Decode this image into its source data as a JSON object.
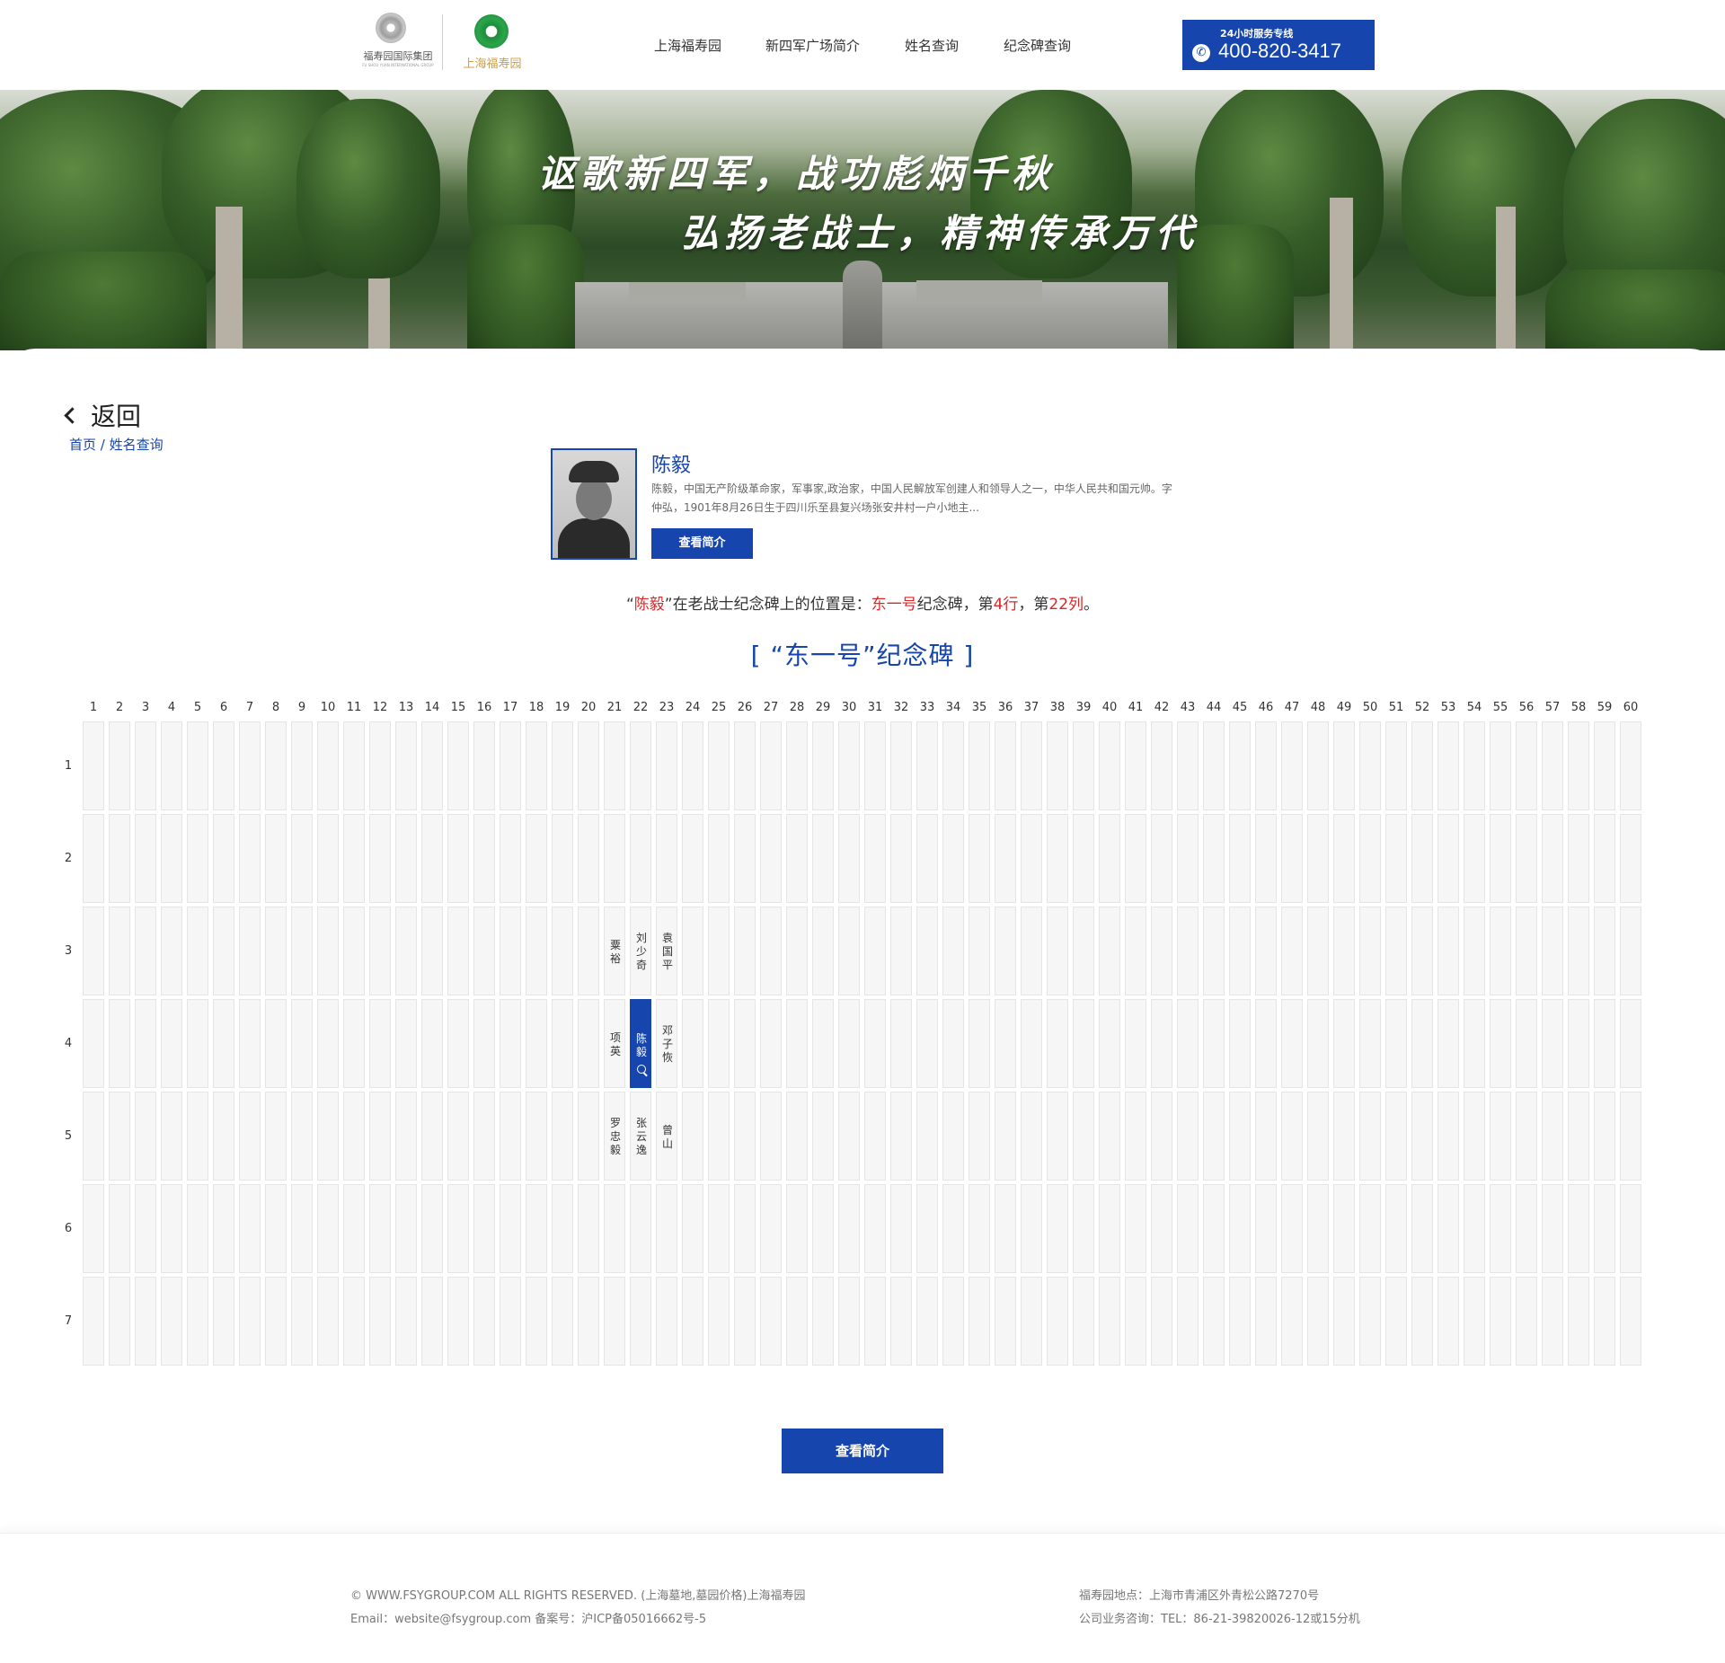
{
  "header": {
    "logo_group_name": "福寿园国际集团",
    "logo_group_sub": "FU SHOU YUAN INTERNATIONAL GROUP",
    "logo_park_name": "上海福寿园",
    "nav": [
      "上海福寿园",
      "新四军广场简介",
      "姓名查询",
      "纪念碑查询"
    ],
    "hotline_title": "24小时服务专线",
    "hotline_number": "400-820-3417"
  },
  "banner": {
    "slogan_line1": "讴歌新四军，战功彪炳千秋",
    "slogan_line2": "弘扬老战士，精神传承万代"
  },
  "content": {
    "back_label": "返回",
    "breadcrumb": "首页 / 姓名查询",
    "profile": {
      "name": "陈毅",
      "description": "陈毅，中国无产阶级革命家，军事家,政治家，中国人民解放军创建人和领导人之一，中华人民共和国元帅。字仲弘，1901年8月26日生于四川乐至县复兴场张安井村一户小地主...",
      "button_label": "查看简介"
    },
    "location": {
      "open_quote": "“",
      "name": "陈毅",
      "mid1": "”在老战士纪念碑上的位置是：",
      "monument": "东一号",
      "mid2": "纪念碑，第",
      "row": "4行",
      "mid3": "，第",
      "col": "22列",
      "end": "。"
    },
    "monument_title": "[ “东一号”纪念碑 ]",
    "grid": {
      "columns": 60,
      "rows": 7,
      "entries": [
        {
          "row": 3,
          "col": 21,
          "name": "粟裕"
        },
        {
          "row": 3,
          "col": 22,
          "name": "刘少奇"
        },
        {
          "row": 3,
          "col": 23,
          "name": "袁国平"
        },
        {
          "row": 4,
          "col": 21,
          "name": "项英"
        },
        {
          "row": 4,
          "col": 22,
          "name": "陈毅",
          "active": true
        },
        {
          "row": 4,
          "col": 23,
          "name": "邓子恢"
        },
        {
          "row": 5,
          "col": 21,
          "name": "罗忠毅"
        },
        {
          "row": 5,
          "col": 22,
          "name": "张云逸"
        },
        {
          "row": 5,
          "col": 23,
          "name": "曾山"
        }
      ]
    },
    "bottom_button_label": "查看简介"
  },
  "footer": {
    "copyright": "© WWW.FSYGROUP.COM ALL RIGHTS RESERVED. (上海墓地,墓园价格)上海福寿园",
    "email_line": "Email：website@fsygroup.com 备案号：沪ICP备05016662号-5",
    "address": "福寿园地点：上海市青浦区外青松公路7270号",
    "business": "公司业务咨询：TEL：86-21-39820026-12或15分机"
  },
  "colors": {
    "primary": "#1645ad",
    "highlight": "#d62a2a"
  }
}
